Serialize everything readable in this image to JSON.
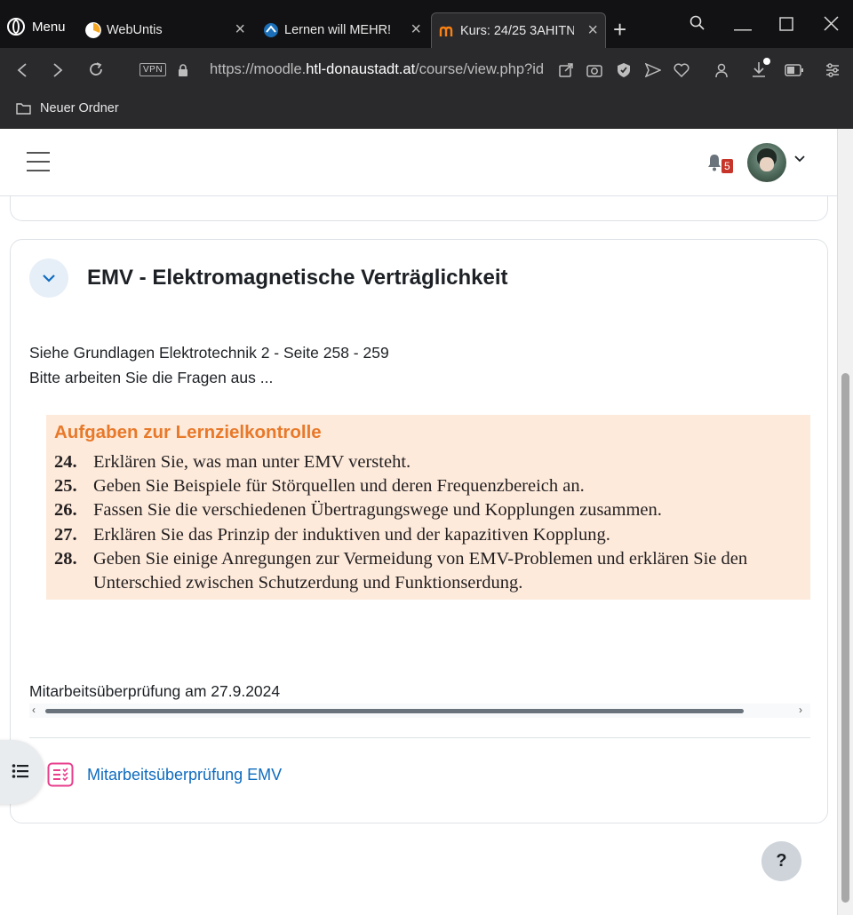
{
  "browser": {
    "menu_label": "Menu",
    "tabs": [
      {
        "label": "WebUntis",
        "icon": "webuntis-icon"
      },
      {
        "label": "Lernen will MEHR!",
        "icon": "lernen-icon"
      },
      {
        "label": "Kurs: 24/25 3AHITN",
        "icon": "moodle-icon",
        "active": true
      }
    ],
    "vpn_label": "VPN",
    "url_prefix": "https://moodle.",
    "url_host": "htl-donaustadt.at",
    "url_path": "/course/view.php?id",
    "bookmark_folder": "Neuer Ordner"
  },
  "header": {
    "notification_count": "5"
  },
  "section": {
    "title": "EMV - Elektromagnetische Verträglichkeit",
    "description_lines": [
      "Siehe Grundlagen Elektrotechnik 2 - Seite 258 - 259",
      "Bitte arbeiten Sie die Fragen aus ..."
    ],
    "task_heading": "Aufgaben zur Lernzielkontrolle",
    "tasks": [
      {
        "num": "24.",
        "text": "Erklären Sie, was man unter EMV versteht."
      },
      {
        "num": "25.",
        "text": "Geben Sie Beispiele für Störquellen und deren Frequenzbereich an."
      },
      {
        "num": "26.",
        "text": "Fassen Sie die verschiedenen Übertragungswege und Kopplungen zusammen."
      },
      {
        "num": "27.",
        "text": "Erklären Sie das Prinzip der induktiven und der kapazitiven Kopplung."
      },
      {
        "num": "28.",
        "text": "Geben Sie einige Anregungen zur Vermeidung von EMV-Problemen und erklären Sie den Unterschied zwischen Schutzerdung und Funktionserdung."
      }
    ],
    "mitarbeit_text": "Mitarbeitsüberprüfung am 27.9.2024",
    "activity_link": "Mitarbeitsüberprüfung EMV"
  },
  "help_label": "?",
  "colors": {
    "link": "#0f6cbf",
    "task_heading": "#e8792a",
    "task_background": "#fdeadb",
    "badge": "#c7352a",
    "activity_icon": "#e83e8c"
  }
}
